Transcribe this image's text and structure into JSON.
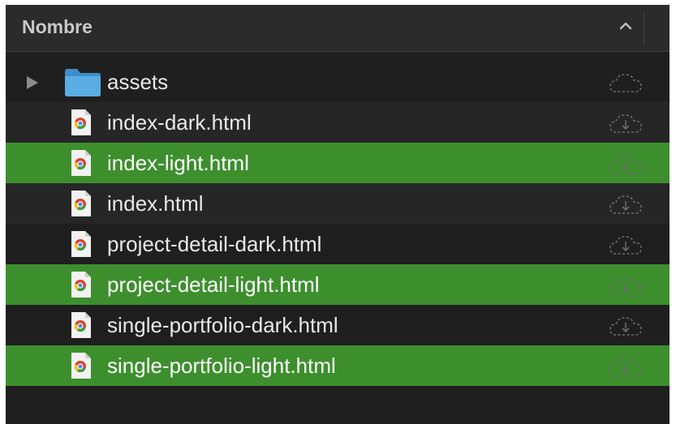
{
  "header": {
    "column_label": "Nombre",
    "sort_icon": "chevron-up-icon"
  },
  "colors": {
    "background": "#1f1f1f",
    "row_alt": "#262626",
    "selection": "#3d8f2e",
    "folder": "#5aaee3"
  },
  "files": [
    {
      "name": "assets",
      "kind": "folder",
      "selected": false,
      "icon": "folder-icon",
      "status_icon": "cloud-icon"
    },
    {
      "name": "index-dark.html",
      "kind": "file",
      "selected": false,
      "icon": "chrome-html-file-icon",
      "status_icon": "cloud-download-icon"
    },
    {
      "name": "index-light.html",
      "kind": "file",
      "selected": true,
      "icon": "chrome-html-file-icon",
      "status_icon": "cloud-download-icon"
    },
    {
      "name": "index.html",
      "kind": "file",
      "selected": false,
      "icon": "chrome-html-file-icon",
      "status_icon": "cloud-download-icon"
    },
    {
      "name": "project-detail-dark.html",
      "kind": "file",
      "selected": false,
      "icon": "chrome-html-file-icon",
      "status_icon": "cloud-download-icon"
    },
    {
      "name": "project-detail-light.html",
      "kind": "file",
      "selected": true,
      "icon": "chrome-html-file-icon",
      "status_icon": "cloud-download-icon"
    },
    {
      "name": "single-portfolio-dark.html",
      "kind": "file",
      "selected": false,
      "icon": "chrome-html-file-icon",
      "status_icon": "cloud-download-icon"
    },
    {
      "name": "single-portfolio-light.html",
      "kind": "file",
      "selected": true,
      "icon": "chrome-html-file-icon",
      "status_icon": "cloud-download-icon"
    }
  ]
}
